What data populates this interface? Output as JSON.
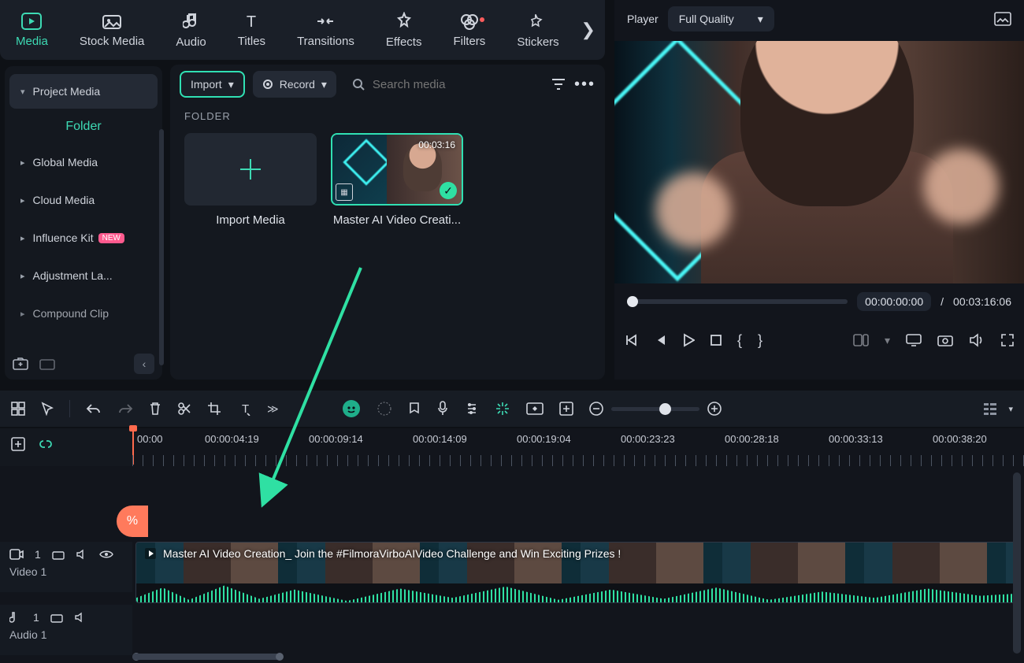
{
  "accent": "#3ddab4",
  "tabs": [
    {
      "id": "media",
      "label": "Media",
      "icon": "media-icon",
      "active": true
    },
    {
      "id": "stock",
      "label": "Stock Media",
      "icon": "stock-icon"
    },
    {
      "id": "audio",
      "label": "Audio",
      "icon": "audio-icon"
    },
    {
      "id": "titles",
      "label": "Titles",
      "icon": "titles-icon"
    },
    {
      "id": "transitions",
      "label": "Transitions",
      "icon": "transitions-icon"
    },
    {
      "id": "effects",
      "label": "Effects",
      "icon": "effects-icon"
    },
    {
      "id": "filters",
      "label": "Filters",
      "icon": "filters-icon",
      "dot": true
    },
    {
      "id": "stickers",
      "label": "Stickers",
      "icon": "stickers-icon"
    }
  ],
  "sidebar": {
    "items": [
      {
        "label": "Project Media",
        "expanded": true
      },
      {
        "folder_label": "Folder"
      },
      {
        "label": "Global Media"
      },
      {
        "label": "Cloud Media"
      },
      {
        "label": "Influence Kit",
        "badge": "NEW"
      },
      {
        "label": "Adjustment La..."
      },
      {
        "label": "Compound Clip"
      }
    ]
  },
  "media_panel": {
    "import_label": "Import",
    "record_label": "Record",
    "search_placeholder": "Search media",
    "folder_heading": "FOLDER",
    "cards": [
      {
        "caption": "Import Media",
        "type": "add"
      },
      {
        "caption": "Master AI Video Creati...",
        "duration": "00:03:16",
        "selected": true
      }
    ]
  },
  "player": {
    "title": "Player",
    "quality": "Full Quality",
    "current": "00:00:00:00",
    "sep": "/",
    "total": "00:03:16:06"
  },
  "timeline": {
    "ruler": [
      "00:00",
      "00:00:04:19",
      "00:00:09:14",
      "00:00:14:09",
      "00:00:19:04",
      "00:00:23:23",
      "00:00:28:18",
      "00:00:33:13",
      "00:00:38:20"
    ],
    "track_video": {
      "name": "Video 1",
      "index": "1"
    },
    "track_audio": {
      "name": "Audio 1",
      "index": "1"
    },
    "clip_title": "Master AI Video Creation_ Join the #FilmoraVirboAIVideo Challenge and Win Exciting Prizes !",
    "pin": "%"
  }
}
